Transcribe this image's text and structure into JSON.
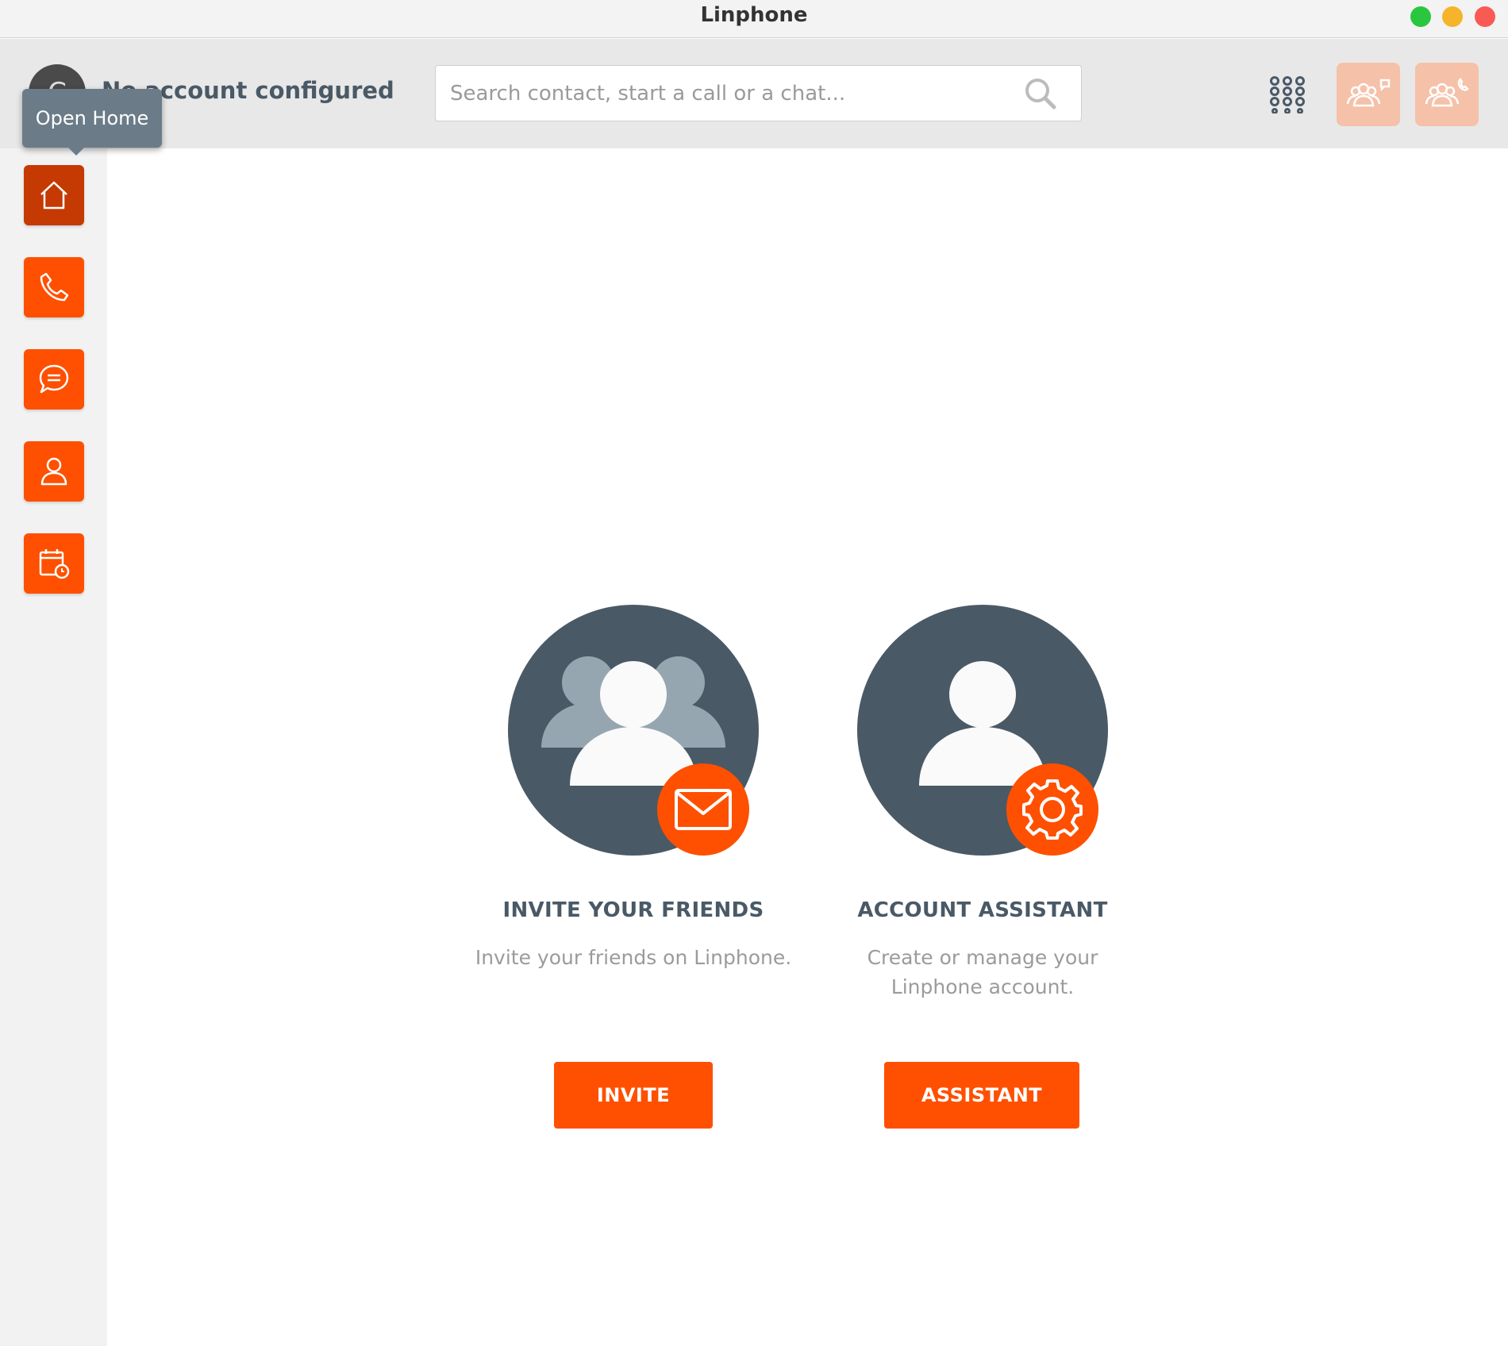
{
  "window": {
    "title": "Linphone"
  },
  "header": {
    "avatar_initial": "C",
    "account_name": "No account configured",
    "search_placeholder": "Search contact, start a call or a chat..."
  },
  "tooltip": {
    "text": "Open Home"
  },
  "sidebar": {
    "items": [
      {
        "icon": "home-icon",
        "active": true
      },
      {
        "icon": "phone-icon"
      },
      {
        "icon": "chat-icon"
      },
      {
        "icon": "contact-icon"
      },
      {
        "icon": "meeting-icon"
      }
    ]
  },
  "cards": {
    "invite": {
      "title": "INVITE YOUR FRIENDS",
      "description": "Invite your friends on Linphone.",
      "button": "INVITE"
    },
    "assistant": {
      "title": "ACCOUNT ASSISTANT",
      "description_line1": "Create or manage your",
      "description_line2": "Linphone account.",
      "button": "ASSISTANT"
    }
  },
  "colors": {
    "accent": "#fe5000",
    "accent_active": "#c43a02",
    "accent_light": "#f5c1a9",
    "dark_slate": "#4a5966",
    "tooltip_bg": "#6b7c88"
  }
}
